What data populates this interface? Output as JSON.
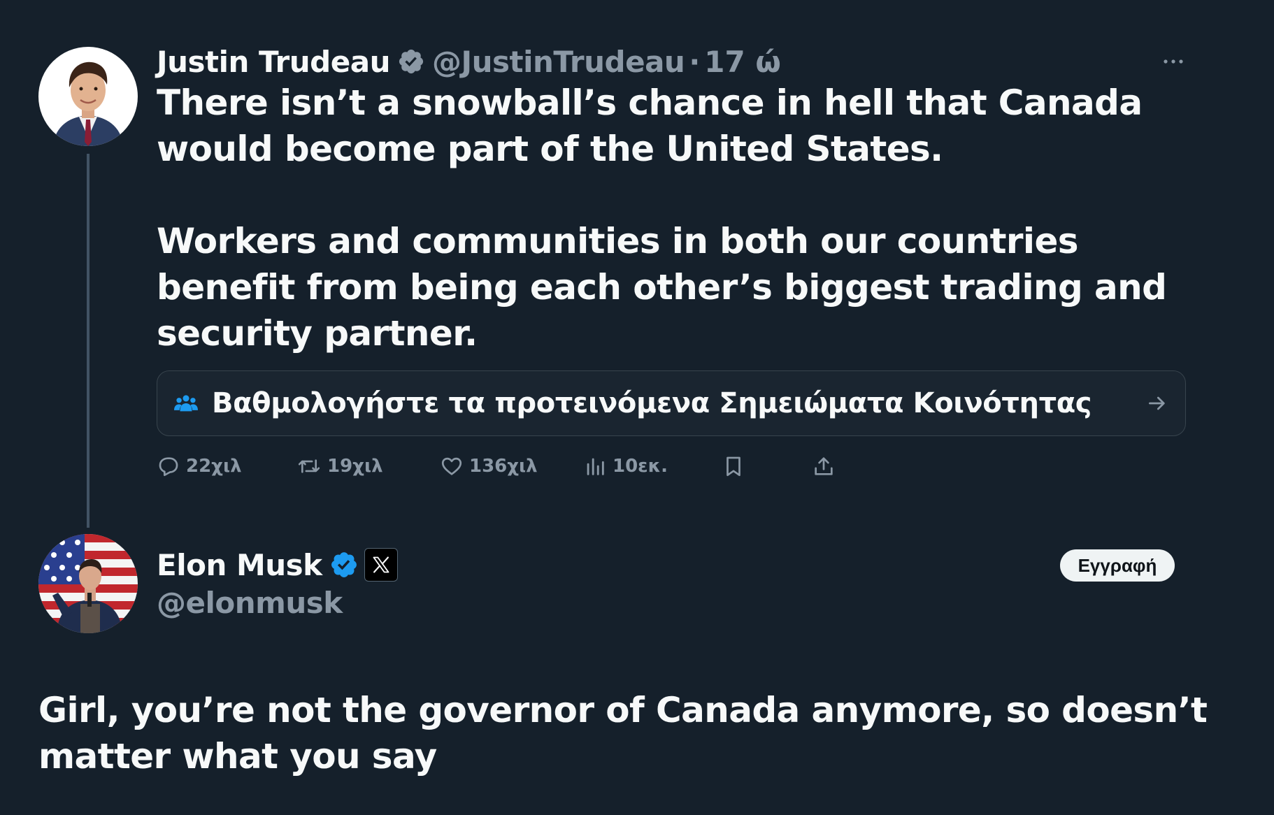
{
  "tweet1": {
    "author_name": "Justin Trudeau",
    "handle": "@JustinTrudeau",
    "separator": "·",
    "time": "17 ώ",
    "paragraph1": "There isn’t a snowball’s chance in hell that Canada would become part of the United States.",
    "paragraph2": "Workers and communities in both our countries benefit from being each other’s biggest trading and security partner.",
    "community_notes_prompt": "Βαθμολογήστε τα προτεινόμενα Σημειώματα Κοινότητας",
    "actions": {
      "replies": "22χιλ",
      "reposts": "19χιλ",
      "likes": "136χιλ",
      "views": "10εκ."
    }
  },
  "tweet2": {
    "author_name": "Elon Musk",
    "handle": "@elonmusk",
    "subscribe_label": "Εγγραφή",
    "text": "Girl, you’re not the governor of Canada anymore, so doesn’t matter what you say"
  },
  "colors": {
    "background": "#15202b",
    "text": "#f7f9f9",
    "muted": "#8b98a5",
    "verified_blue": "#1d9bf0",
    "border": "#38444d"
  },
  "icons": [
    "verified-badge-icon",
    "more-icon",
    "community-notes-icon",
    "arrow-right-icon",
    "reply-icon",
    "repost-icon",
    "like-icon",
    "views-icon",
    "bookmark-icon",
    "share-icon",
    "x-logo-icon"
  ]
}
